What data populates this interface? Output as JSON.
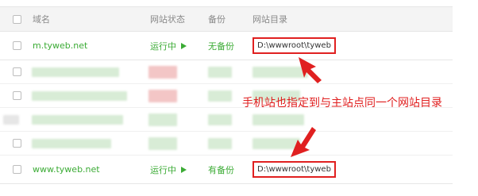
{
  "table": {
    "headers": {
      "domain": "域名",
      "status": "网站状态",
      "backup": "备份",
      "dir": "网站目录"
    },
    "rows": [
      {
        "domain": "m.tyweb.net",
        "status": "运行中",
        "backup": "无备份",
        "dir": "D:\\wwwroot\\tyweb"
      },
      {
        "domain": "www.tyweb.net",
        "status": "运行中",
        "backup": "有备份",
        "dir": "D:\\wwwroot\\tyweb"
      }
    ]
  },
  "annotation": {
    "text": "手机站也指定到与主站点同一个网站目录"
  },
  "colors": {
    "green": "#3bab35",
    "red": "#e02020"
  }
}
